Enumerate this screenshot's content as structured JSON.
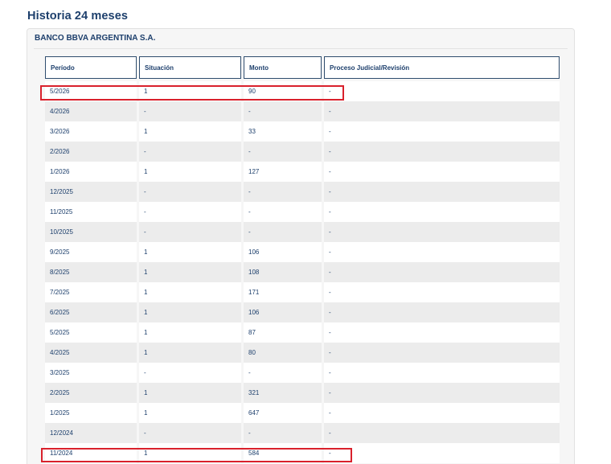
{
  "page": {
    "title": "Historia 24 meses"
  },
  "entity": {
    "name": "BANCO BBVA ARGENTINA S.A."
  },
  "table": {
    "headers": [
      "Período",
      "Situación",
      "Monto",
      "Proceso Judicial/Revisión"
    ],
    "rows": [
      {
        "periodo": "5/2026",
        "situacion": "1",
        "monto": "90",
        "proceso": "-",
        "highlighted": true
      },
      {
        "periodo": "4/2026",
        "situacion": "-",
        "monto": "-",
        "proceso": "-",
        "highlighted": false
      },
      {
        "periodo": "3/2026",
        "situacion": "1",
        "monto": "33",
        "proceso": "-",
        "highlighted": false
      },
      {
        "periodo": "2/2026",
        "situacion": "-",
        "monto": "-",
        "proceso": "-",
        "highlighted": false
      },
      {
        "periodo": "1/2026",
        "situacion": "1",
        "monto": "127",
        "proceso": "-",
        "highlighted": false
      },
      {
        "periodo": "12/2025",
        "situacion": "-",
        "monto": "-",
        "proceso": "-",
        "highlighted": false
      },
      {
        "periodo": "11/2025",
        "situacion": "-",
        "monto": "-",
        "proceso": "-",
        "highlighted": false
      },
      {
        "periodo": "10/2025",
        "situacion": "-",
        "monto": "-",
        "proceso": "-",
        "highlighted": false
      },
      {
        "periodo": "9/2025",
        "situacion": "1",
        "monto": "106",
        "proceso": "-",
        "highlighted": false
      },
      {
        "periodo": "8/2025",
        "situacion": "1",
        "monto": "108",
        "proceso": "-",
        "highlighted": false
      },
      {
        "periodo": "7/2025",
        "situacion": "1",
        "monto": "171",
        "proceso": "-",
        "highlighted": false
      },
      {
        "periodo": "6/2025",
        "situacion": "1",
        "monto": "106",
        "proceso": "-",
        "highlighted": false
      },
      {
        "periodo": "5/2025",
        "situacion": "1",
        "monto": "87",
        "proceso": "-",
        "highlighted": false
      },
      {
        "periodo": "4/2025",
        "situacion": "1",
        "monto": "80",
        "proceso": "-",
        "highlighted": false
      },
      {
        "periodo": "3/2025",
        "situacion": "-",
        "monto": "-",
        "proceso": "-",
        "highlighted": false
      },
      {
        "periodo": "2/2025",
        "situacion": "1",
        "monto": "321",
        "proceso": "-",
        "highlighted": false
      },
      {
        "periodo": "1/2025",
        "situacion": "1",
        "monto": "647",
        "proceso": "-",
        "highlighted": false
      },
      {
        "periodo": "12/2024",
        "situacion": "-",
        "monto": "-",
        "proceso": "-",
        "highlighted": false
      },
      {
        "periodo": "11/2024",
        "situacion": "1",
        "monto": "584",
        "proceso": "-",
        "highlighted": true
      }
    ]
  },
  "colors": {
    "text": "#1d3f6c",
    "highlight": "#d9212c",
    "row_alt": "#ececec",
    "card_bg": "#f6f6f6"
  }
}
